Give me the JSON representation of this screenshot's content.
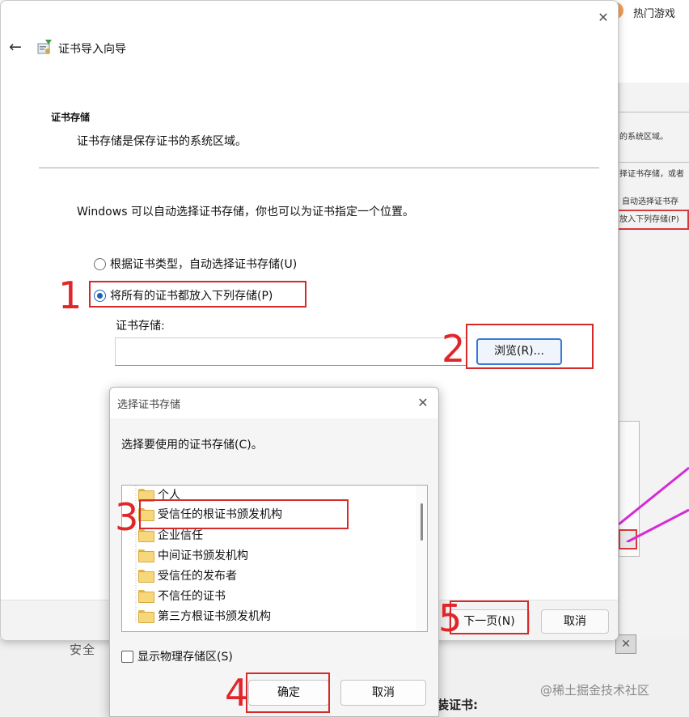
{
  "background": {
    "top_tab_label": "热门游戏",
    "panel_lines": [
      "的系统区域。",
      "择证书存储，或者",
      "自动选择证书存",
      "放入下列存储(P)"
    ],
    "lower_heading": "安全",
    "lower_label": "装证书:",
    "watermark": "@稀土掘金技术社区",
    "close_glyph": "✕"
  },
  "wizard": {
    "title": "证书导入向导",
    "section_title": "证书存储",
    "section_subtitle": "证书存储是保存证书的系统区域。",
    "description": "Windows 可以自动选择证书存储，你也可以为证书指定一个位置。",
    "radio_auto_label": "根据证书类型，自动选择证书存储(U)",
    "radio_manual_label": "将所有的证书都放入下列存储(P)",
    "radio_selected": "manual",
    "store_label": "证书存储:",
    "store_value": "",
    "browse_label": "浏览(R)...",
    "next_label": "下一页(N)",
    "cancel_label": "取消",
    "back_glyph": "←",
    "close_glyph": "✕"
  },
  "dialog": {
    "title": "选择证书存储",
    "prompt": "选择要使用的证书存储(C)。",
    "stores": [
      "个人",
      "受信任的根证书颁发机构",
      "企业信任",
      "中间证书颁发机构",
      "受信任的发布者",
      "不信任的证书",
      "第三方根证书颁发机构"
    ],
    "selected_store": "受信任的根证书颁发机构",
    "show_physical_label": "显示物理存储区(S)",
    "show_physical_checked": false,
    "ok_label": "确定",
    "cancel_label": "取消",
    "close_glyph": "✕"
  },
  "annotations": {
    "step_numbers": [
      "1",
      "2",
      "3",
      "4",
      "5"
    ],
    "color": "#d62a2a"
  }
}
